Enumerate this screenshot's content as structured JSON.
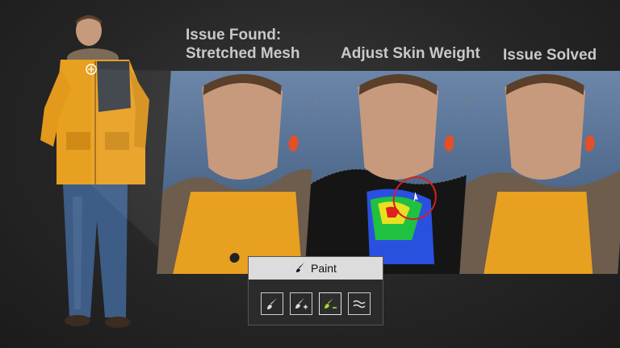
{
  "headings": {
    "issue_found": "Issue Found:",
    "stretched_mesh": "Stretched Mesh",
    "adjust_skin_weight": "Adjust Skin Weight",
    "issue_solved": "Issue Solved"
  },
  "toolbar": {
    "title": "Paint",
    "tools": [
      {
        "icon": "brush-icon"
      },
      {
        "icon": "brush-add-icon"
      },
      {
        "icon": "brush-subtract-icon",
        "active": true
      },
      {
        "icon": "smooth-icon"
      }
    ]
  },
  "colors": {
    "jacket": "#e8a020",
    "jeans": "#3d5c86",
    "panel_sky": "#5a7698",
    "active_tool": "#a8d830",
    "highlight_circle": "#d42020"
  }
}
